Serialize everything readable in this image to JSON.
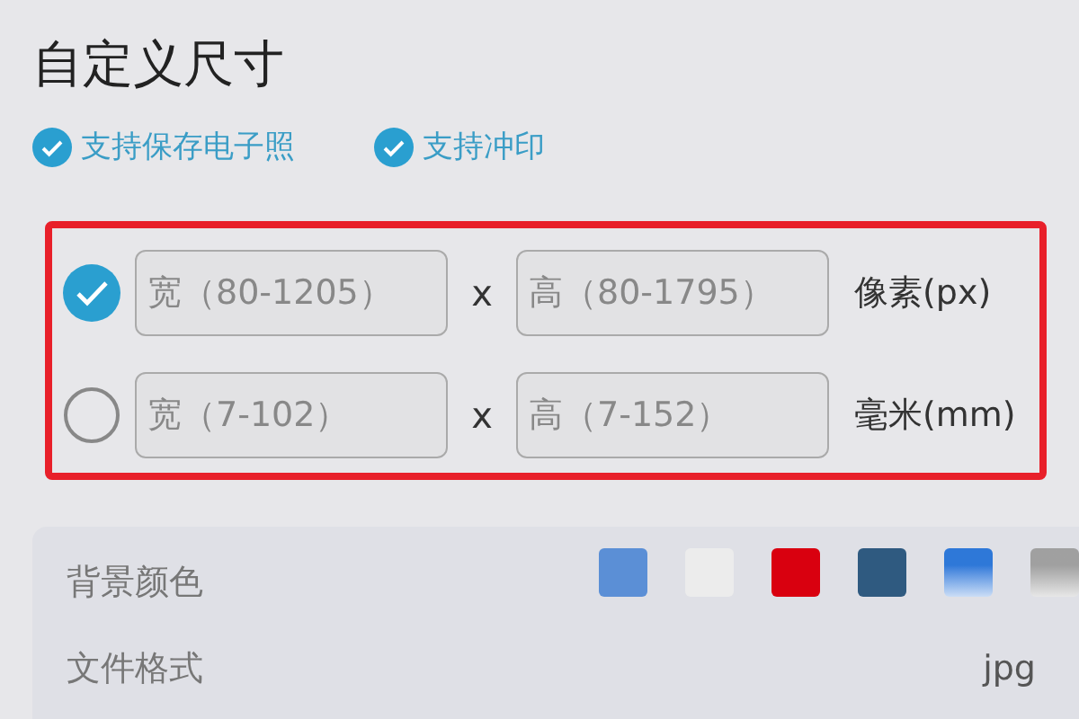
{
  "title": "自定义尺寸",
  "features": [
    {
      "label": "支持保存电子照",
      "checked": true
    },
    {
      "label": "支持冲印",
      "checked": true
    }
  ],
  "size_options": [
    {
      "selected": true,
      "width_placeholder": "宽（80-1205）",
      "separator": "x",
      "height_placeholder": "高（80-1795）",
      "unit": "像素(px)"
    },
    {
      "selected": false,
      "width_placeholder": "宽（7-102）",
      "separator": "x",
      "height_placeholder": "高（7-152）",
      "unit": "毫米(mm)"
    }
  ],
  "settings": {
    "background_label": "背景颜色",
    "swatches": [
      {
        "kind": "solid",
        "color": "#5b8fd6"
      },
      {
        "kind": "solid",
        "color": "#ececec"
      },
      {
        "kind": "solid",
        "color": "#d9000f"
      },
      {
        "kind": "solid",
        "color": "#2f5a80"
      },
      {
        "kind": "gradient",
        "color": "#2e78d8"
      },
      {
        "kind": "gradient",
        "color": "#a0a0a0"
      }
    ],
    "format_label": "文件格式",
    "format_value": "jpg"
  }
}
